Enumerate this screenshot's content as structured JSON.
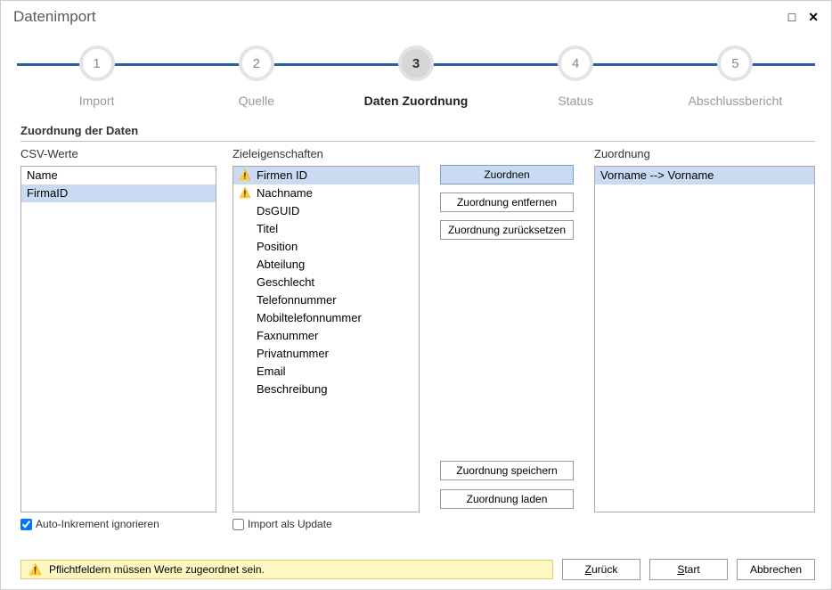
{
  "window": {
    "title": "Datenimport"
  },
  "stepper": {
    "steps": [
      {
        "num": "1",
        "label": "Import"
      },
      {
        "num": "2",
        "label": "Quelle"
      },
      {
        "num": "3",
        "label": "Daten Zuordnung"
      },
      {
        "num": "4",
        "label": "Status"
      },
      {
        "num": "5",
        "label": "Abschlussbericht"
      }
    ],
    "active_index": 2
  },
  "section_header": "Zuordnung der Daten",
  "columns": {
    "csv": {
      "header": "CSV-Werte",
      "items": [
        {
          "label": "Name",
          "selected": false
        },
        {
          "label": "FirmaID",
          "selected": true
        }
      ]
    },
    "ziel": {
      "header": "Zieleigenschaften",
      "items": [
        {
          "label": "Firmen ID",
          "warn": true,
          "selected": true
        },
        {
          "label": "Nachname",
          "warn": true
        },
        {
          "label": "DsGUID"
        },
        {
          "label": "Titel"
        },
        {
          "label": "Position"
        },
        {
          "label": "Abteilung"
        },
        {
          "label": "Geschlecht"
        },
        {
          "label": "Telefonnummer"
        },
        {
          "label": "Mobiltelefonnummer"
        },
        {
          "label": "Faxnummer"
        },
        {
          "label": "Privatnummer"
        },
        {
          "label": "Email"
        },
        {
          "label": "Beschreibung"
        }
      ]
    },
    "zuord": {
      "header": "Zuordnung",
      "items": [
        {
          "label": "Vorname --> Vorname",
          "selected": true
        }
      ]
    }
  },
  "buttons": {
    "assign": "Zuordnen",
    "remove": "Zuordnung entfernen",
    "reset": "Zuordnung zurücksetzen",
    "save": "Zuordnung speichern",
    "load": "Zuordnung laden"
  },
  "checks": {
    "auto_inc": {
      "label": "Auto-Inkrement ignorieren",
      "checked": true
    },
    "as_update": {
      "label": "Import als Update",
      "checked": false
    }
  },
  "message": "Pflichtfeldern müssen Werte zugeordnet sein.",
  "footer": {
    "back": "Zurück",
    "start": "Start",
    "cancel": "Abbrechen"
  }
}
